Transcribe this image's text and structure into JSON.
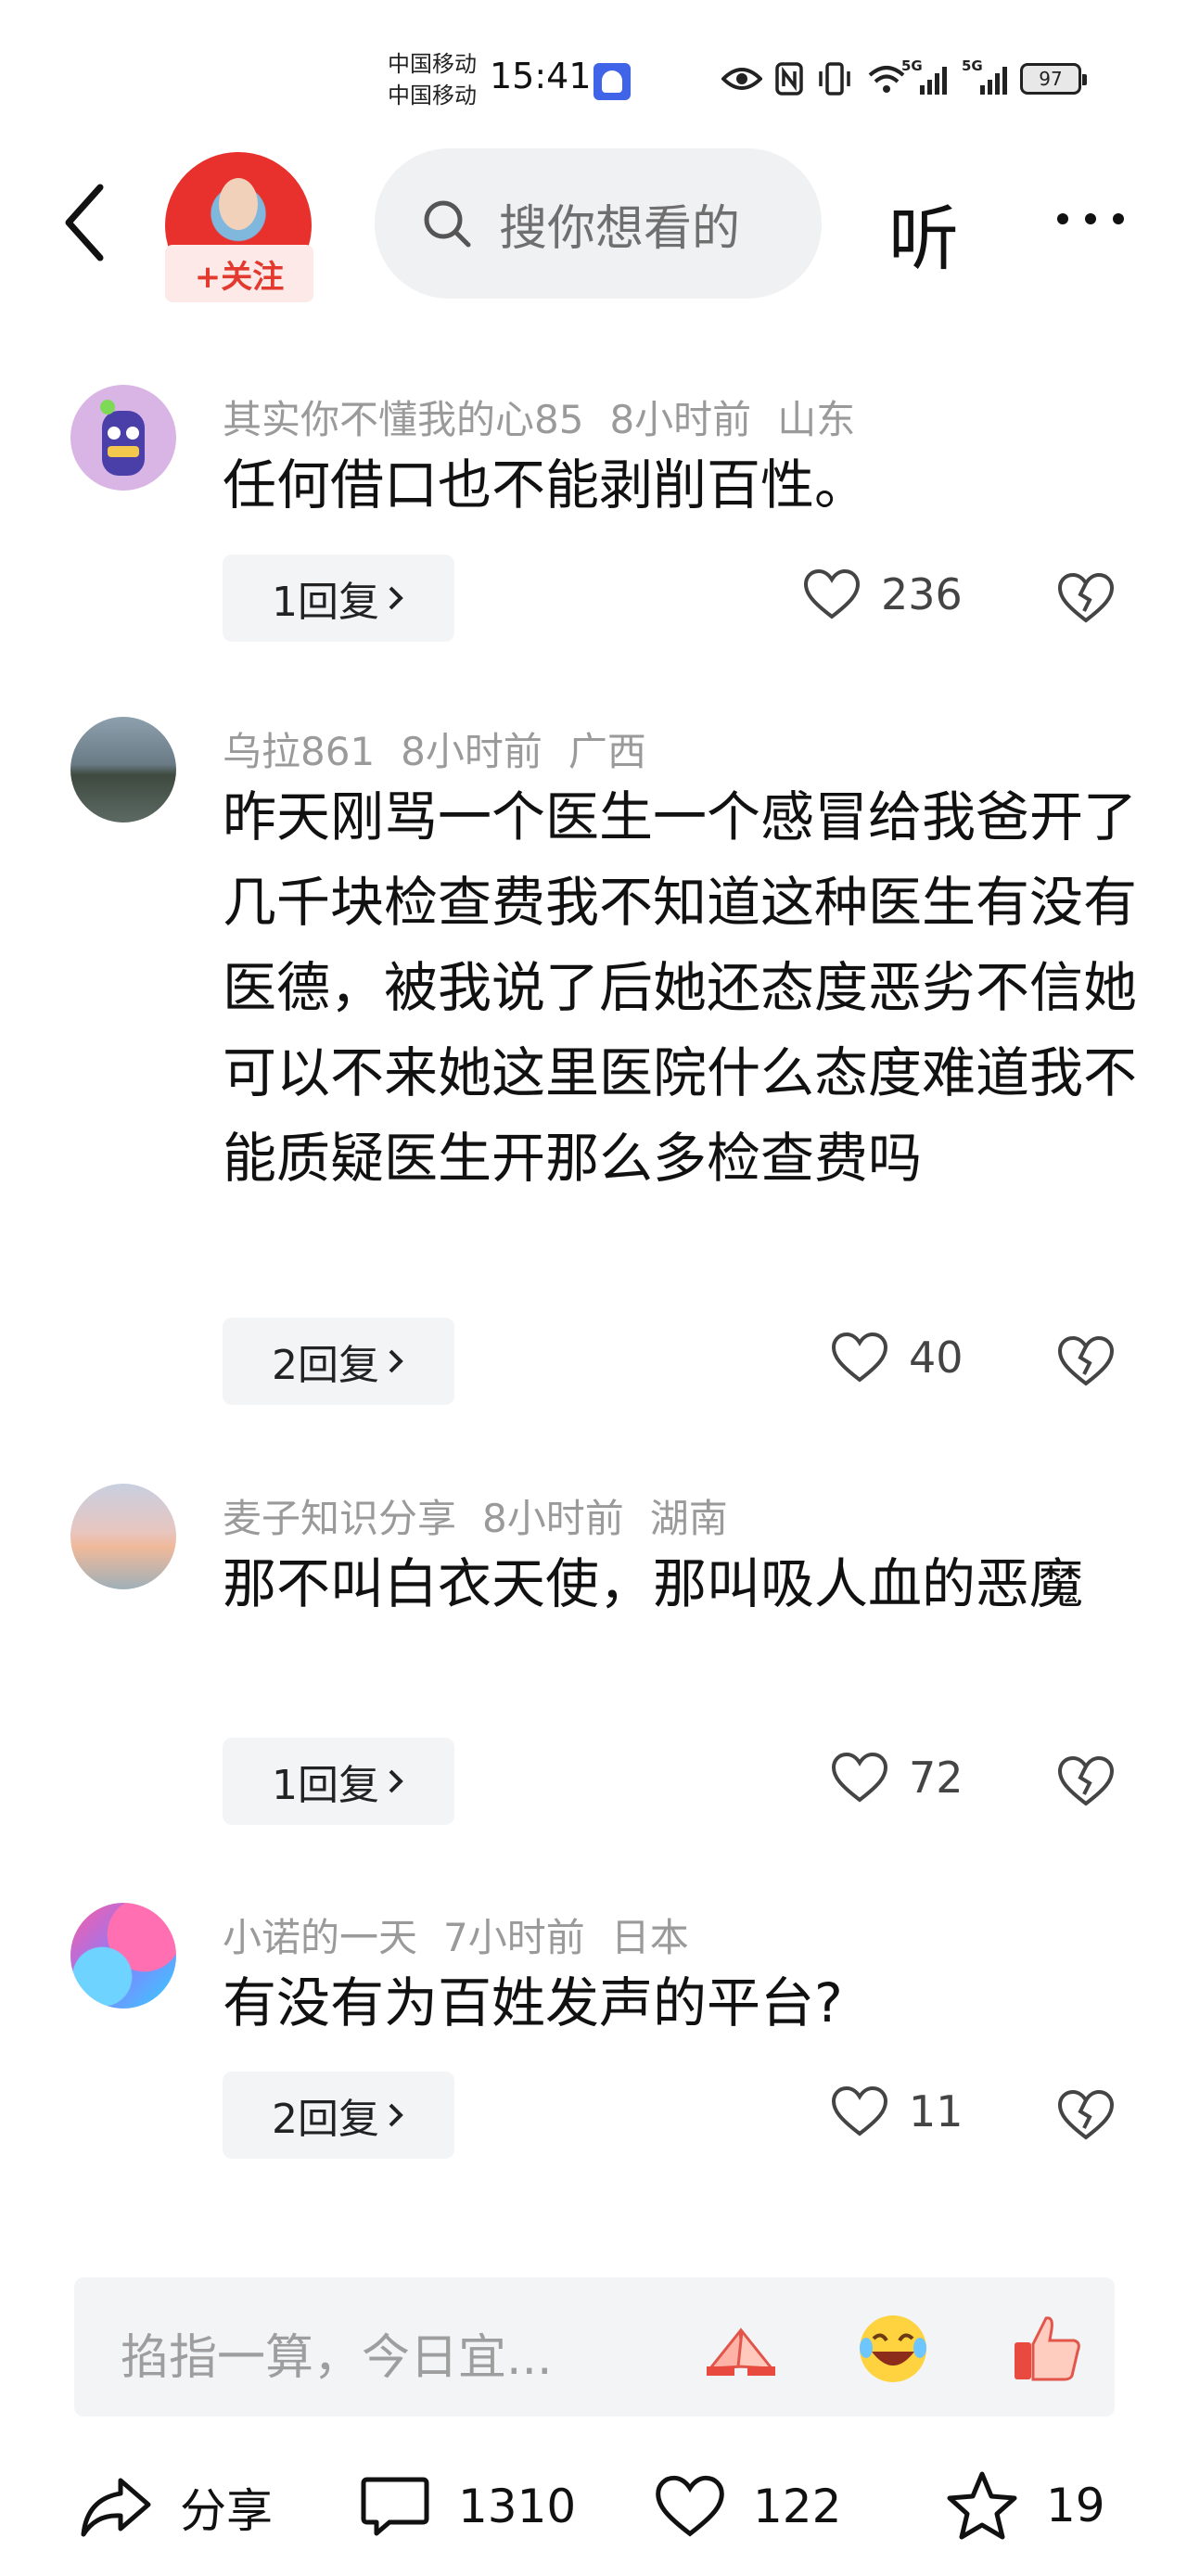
{
  "status_bar": {
    "carrier_1": "中国移动",
    "carrier_2": "中国移动",
    "time": "15:41",
    "network_1": "5G",
    "network_2": "5G",
    "battery": "97"
  },
  "header": {
    "follow_label": "+关注",
    "search_placeholder": "搜你想看的",
    "listen_label": "听"
  },
  "comments": [
    {
      "username": "其实你不懂我的心85",
      "time": "8小时前",
      "location": "山东",
      "text": "任何借口也不能剥削百性。",
      "replies": "1回复",
      "likes": "236"
    },
    {
      "username": "乌拉861",
      "time": "8小时前",
      "location": "广西",
      "text": "昨天刚骂一个医生一个感冒给我爸开了几千块检查费我不知道这种医生有没有医德，被我说了后她还态度恶劣不信她可以不来她这里医院什么态度难道我不能质疑医生开那么多检查费吗",
      "replies": "2回复",
      "likes": "40"
    },
    {
      "username": "麦子知识分享",
      "time": "8小时前",
      "location": "湖南",
      "text": "那不叫白衣天使，那叫吸人血的恶魔",
      "replies": "1回复",
      "likes": "72"
    },
    {
      "username": "小诺的一天",
      "time": "7小时前",
      "location": "日本",
      "text": "有没有为百姓发声的平台?",
      "replies": "2回复",
      "likes": "11"
    }
  ],
  "comment_input": {
    "placeholder": "掐指一算，今日宜..."
  },
  "bottom_bar": {
    "share_label": "分享",
    "comments_count": "1310",
    "likes_count": "122",
    "favorites_count": "19"
  }
}
